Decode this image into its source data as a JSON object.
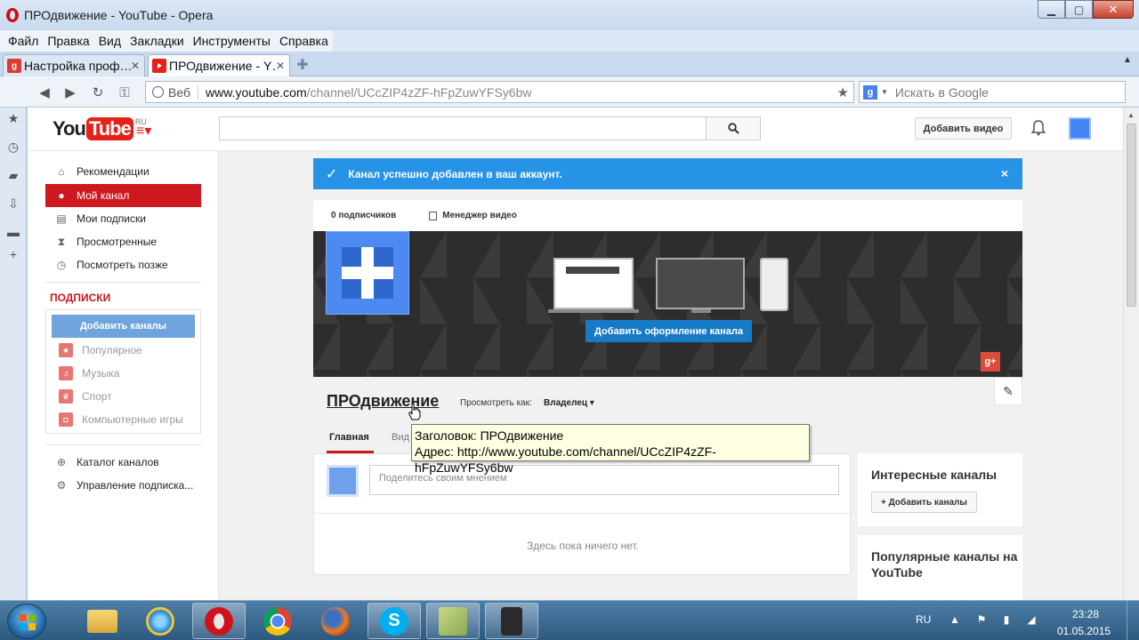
{
  "window": {
    "title": "ПРОдвижение - YouTube - Opera",
    "controls": {
      "minimize": "▁",
      "maximize": "▢",
      "close": "✕"
    }
  },
  "menu": [
    "Файл",
    "Правка",
    "Вид",
    "Закладки",
    "Инструменты",
    "Справка"
  ],
  "tabs": [
    {
      "label": "Настройка проф…"
    },
    {
      "label": "ПРОдвижение - Y…"
    }
  ],
  "navbar": {
    "web_label": "Веб",
    "url_host": "www.youtube.com",
    "url_path": "/channel/UCcZIP4zZF-hFpZuwYFSy6bw",
    "search_placeholder": "Искать в Google"
  },
  "youtube": {
    "logo_you": "You",
    "logo_tube": "Tube",
    "logo_region": "RU",
    "upload_label": "Добавить видео"
  },
  "guide": {
    "items": [
      {
        "label": "Рекомендации",
        "icon": "home-icon"
      },
      {
        "label": "Мой канал",
        "icon": "user-icon"
      },
      {
        "label": "Мои подписки",
        "icon": "subscriptions-icon"
      },
      {
        "label": "Просмотренные",
        "icon": "hourglass-icon"
      },
      {
        "label": "Посмотреть позже",
        "icon": "clock-icon"
      }
    ],
    "subscriptions_heading": "ПОДПИСКИ",
    "add_channels": "Добавить каналы",
    "subscriptions": [
      {
        "label": "Популярное"
      },
      {
        "label": "Музыка"
      },
      {
        "label": "Спорт"
      },
      {
        "label": "Компьютерные игры"
      }
    ],
    "bottom": [
      {
        "label": "Каталог каналов"
      },
      {
        "label": "Управление подписка..."
      }
    ]
  },
  "alert": {
    "text": "Канал успешно добавлен в ваш аккаунт.",
    "close": "×"
  },
  "stats": {
    "subscribers": "0 подписчиков",
    "video_manager": "Менеджер видео"
  },
  "banner": {
    "button": "Добавить оформление канала",
    "gplus": "g+"
  },
  "channel": {
    "name": "ПРОдвижение",
    "view_as_label": "Просмотреть как:",
    "view_as_value": "Владелец",
    "tabs": [
      "Главная",
      "Вид"
    ]
  },
  "feed": {
    "placeholder": "Поделитесь своим мнением",
    "empty": "Здесь пока ничего нет."
  },
  "sidebar_cards": {
    "interesting_title": "Интересные каналы",
    "add_button": "+ Добавить каналы",
    "popular_title": "Популярные каналы на YouTube"
  },
  "tooltip": {
    "line1": "Заголовок: ПРОдвижение",
    "line2": "Адрес: http://www.youtube.com/channel/UCcZIP4zZF-hFpZuwYFSy6bw"
  },
  "taskbar": {
    "lang": "RU",
    "time": "23:28",
    "date": "01.05.2015"
  },
  "colors": {
    "youtube_red": "#e62117",
    "active_guide": "#cc181e",
    "alert_blue": "#2793e6",
    "button_blue": "#167ac6"
  }
}
